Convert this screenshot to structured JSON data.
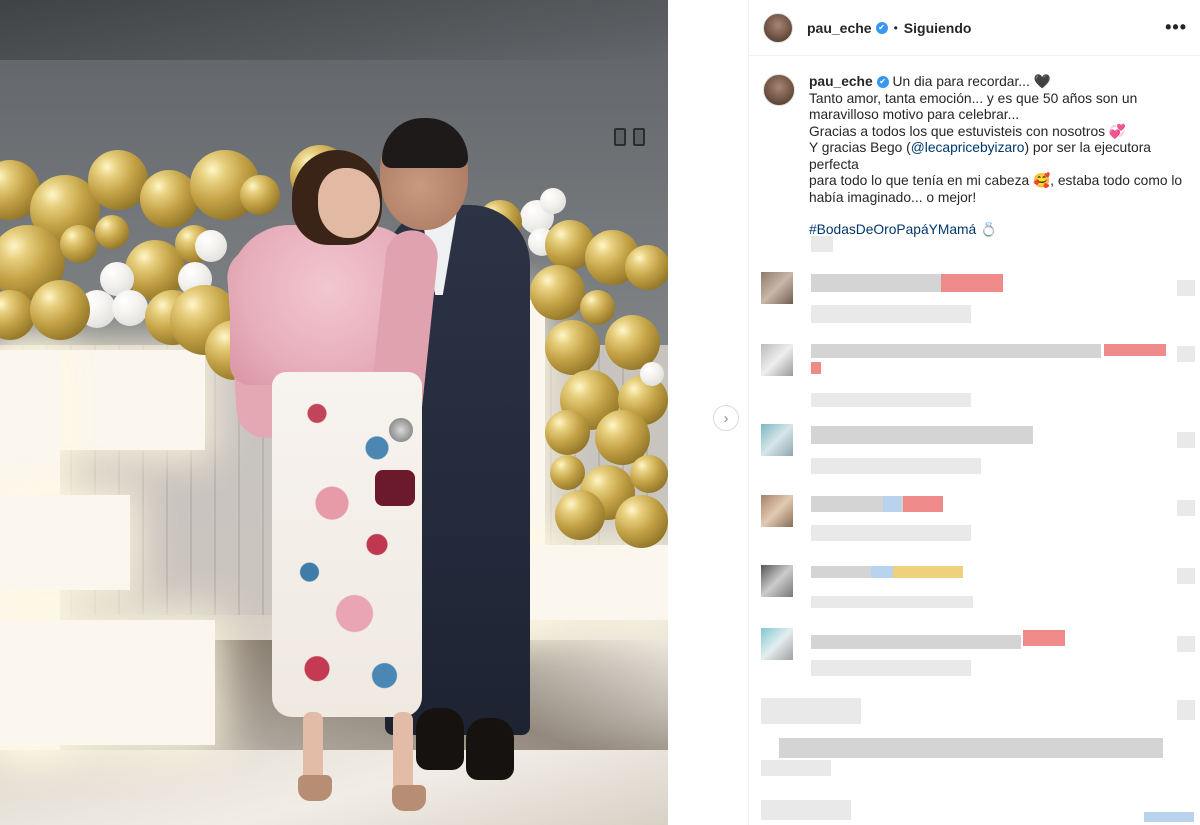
{
  "post": {
    "username": "pau_eche",
    "verified_icon": "✔",
    "separator": "•",
    "follow_status": "Siguiendo",
    "more_icon": "•••",
    "next_icon": "›"
  },
  "caption": {
    "username": "pau_eche",
    "lines": [
      "Un dia para recordar... 🖤",
      "Tanto amor, tanta emoción... y es que 50 años son un",
      "maravilloso motivo para celebrar...",
      "Gracias a todos los que estuvisteis con nosotros 💞"
    ],
    "bego_prefix": "Y gracias Bego (",
    "mention": "@lecapricebyizaro",
    "bego_suffix": ") por ser la ejecutora perfecta",
    "line_after_1": "para todo lo que tenía en mi cabeza 🥰, estaba todo como lo",
    "line_after_2": "había imaginado... o mejor!",
    "hashtag": "#BodasDeOroPapáYMamá",
    "hashtag_emoji": "💍"
  },
  "colors": {
    "text": "#262626",
    "link": "#00376b",
    "verified": "#3897f0",
    "border": "#efefef"
  }
}
